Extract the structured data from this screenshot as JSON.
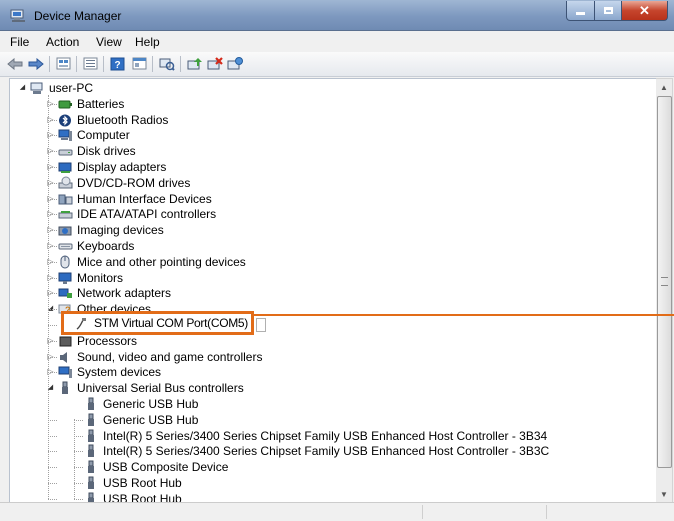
{
  "window": {
    "title": "Device Manager"
  },
  "menu": [
    "File",
    "Action",
    "View",
    "Help"
  ],
  "toolbar_icons": [
    "back-icon",
    "forward-icon",
    "properties-view-icon",
    "list-view-icon",
    "help-icon",
    "console-icon",
    "scan-hardware-icon",
    "update-driver-icon",
    "uninstall-icon",
    "enable-icon"
  ],
  "tree": {
    "root": "user-PC",
    "categories": [
      {
        "label": "Batteries",
        "icon": "battery-icon",
        "state": "collapsed"
      },
      {
        "label": "Bluetooth Radios",
        "icon": "bluetooth-icon",
        "state": "collapsed"
      },
      {
        "label": "Computer",
        "icon": "computer-icon",
        "state": "collapsed"
      },
      {
        "label": "Disk drives",
        "icon": "disk-drive-icon",
        "state": "collapsed"
      },
      {
        "label": "Display adapters",
        "icon": "display-adapter-icon",
        "state": "collapsed"
      },
      {
        "label": "DVD/CD-ROM drives",
        "icon": "dvd-drive-icon",
        "state": "collapsed"
      },
      {
        "label": "Human Interface Devices",
        "icon": "hid-icon",
        "state": "collapsed"
      },
      {
        "label": "IDE ATA/ATAPI controllers",
        "icon": "ide-controller-icon",
        "state": "collapsed"
      },
      {
        "label": "Imaging devices",
        "icon": "camera-icon",
        "state": "collapsed"
      },
      {
        "label": "Keyboards",
        "icon": "keyboard-icon",
        "state": "collapsed"
      },
      {
        "label": "Mice and other pointing devices",
        "icon": "mouse-icon",
        "state": "collapsed"
      },
      {
        "label": "Monitors",
        "icon": "monitor-icon",
        "state": "collapsed"
      },
      {
        "label": "Network adapters",
        "icon": "network-adapter-icon",
        "state": "collapsed"
      },
      {
        "label": "Other devices",
        "icon": "unknown-device-icon",
        "state": "expanded"
      },
      {
        "label": "Processors",
        "icon": "processor-icon",
        "state": "collapsed"
      },
      {
        "label": "Sound, video and game controllers",
        "icon": "speaker-icon",
        "state": "collapsed"
      },
      {
        "label": "System devices",
        "icon": "system-device-icon",
        "state": "collapsed"
      },
      {
        "label": "Universal Serial Bus controllers",
        "icon": "usb-icon",
        "state": "expanded"
      }
    ],
    "other_devices_child": "STM Virtual COM Port(COM5)",
    "usb_children": [
      "Generic USB Hub",
      "Generic USB Hub",
      "Intel(R) 5 Series/3400 Series Chipset Family USB Enhanced Host Controller - 3B34",
      "Intel(R) 5 Series/3400 Series Chipset Family USB Enhanced Host Controller - 3B3C",
      "USB Composite Device",
      "USB Root Hub",
      "USB Root Hub"
    ]
  },
  "colors": {
    "callout": "#e26c18",
    "titlebar": "#7d98bf",
    "close": "#c6452d"
  }
}
